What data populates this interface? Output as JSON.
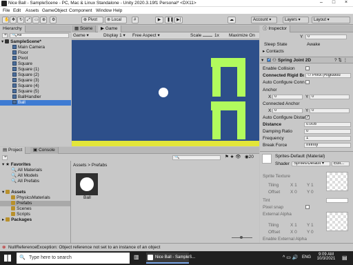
{
  "window": {
    "title": "Nice Ball - SampleScene - PC, Mac & Linux Standalone - Unity 2020.3.19f1 Personal* <DX11>"
  },
  "menu": [
    "File",
    "Edit",
    "Assets",
    "GameObject",
    "Component",
    "Window",
    "Help"
  ],
  "toolbar": {
    "pivot": "Pivot",
    "local": "Local",
    "account": "Account",
    "layers": "Layers",
    "layout": "Layout"
  },
  "hierarchy": {
    "tab": "Hierarchy",
    "search_placeholder": "All",
    "scene": "SampleScene*",
    "items": [
      "Main Camera",
      "Floor",
      "Pivot",
      "Square",
      "Square (1)",
      "Square (2)",
      "Square (3)",
      "Square (4)",
      "Square (5)",
      "BallHandler",
      "Ball"
    ]
  },
  "scene_tabs": {
    "scene": "Scene",
    "game": "Game"
  },
  "game_bar": {
    "display_dropdown": "Game",
    "display": "Display 1",
    "aspect": "Free Aspect",
    "scale_label": "Scale",
    "scale_value": "1x",
    "maximize": "Maximize On"
  },
  "colors": {
    "game_bg": "#2d4f8a",
    "floor": "#e3e63a",
    "pillar": "#b1fb5d",
    "ball": "#ffffff"
  },
  "project": {
    "tab_project": "Project",
    "tab_console": "Console",
    "breadcrumb": "Assets > Prefabs",
    "count": "20",
    "favorites": "Favorites",
    "fav_items": [
      "All Materials",
      "All Models",
      "All Prefabs"
    ],
    "assets": "Assets",
    "asset_items": [
      "PhysicsMaterials",
      "Prefabs",
      "Scenes",
      "Scripts"
    ],
    "packages": "Packages",
    "prefab": "Ball"
  },
  "inspector": {
    "tab": "Inspector",
    "y_label": "Y",
    "y_value": "0",
    "sleep_label": "Sleep State",
    "sleep_value": "Awake",
    "contacts": "Contacts",
    "component": "Spring Joint 2D",
    "enable_collision": "Enable Collision",
    "connected_rb_label": "Connected Rigid Bod",
    "connected_rb_value": "Pivot (Rigidbod",
    "auto_anchor": "Auto Configure Conn",
    "anchor": "Anchor",
    "anchor_x": "0",
    "anchor_y": "0",
    "connected_anchor": "Connected Anchor",
    "ca_x": "0",
    "ca_y": "0",
    "auto_distance": "Auto Configure Distan",
    "distance_label": "Distance",
    "distance_value": "0.005",
    "damping_label": "Damping Ratio",
    "damping_value": "0",
    "frequency_label": "Frequency",
    "frequency_value": "1",
    "break_label": "Break Force",
    "break_value": "Infinity",
    "material": "Sprites-Default (Material)",
    "shader_label": "Shader",
    "shader_value": "Sprites/Default",
    "edit": "Edit...",
    "sprite_texture": "Sprite Texture",
    "tiling": "Tiling",
    "offset": "Offset",
    "t_x": "1",
    "t_y": "1",
    "o_x": "0",
    "o_y": "0",
    "tint": "Tint",
    "pixel_snap": "Pixel snap",
    "external_alpha": "External Alpha",
    "tiling2_x": "1",
    "tiling2_y": "1",
    "offset2_x": "0",
    "offset2_y": "0",
    "enable_ext": "Enable External Alpha",
    "x": "X",
    "yl": "Y"
  },
  "status_msg": "NullReferenceException: Object reference not set to an instance of an object",
  "taskbar": {
    "search": "Type here to search",
    "app": "Nice Ball - SampleS...",
    "time": "9:09 AM",
    "date": "10/3/2021",
    "lang": "ENG"
  }
}
